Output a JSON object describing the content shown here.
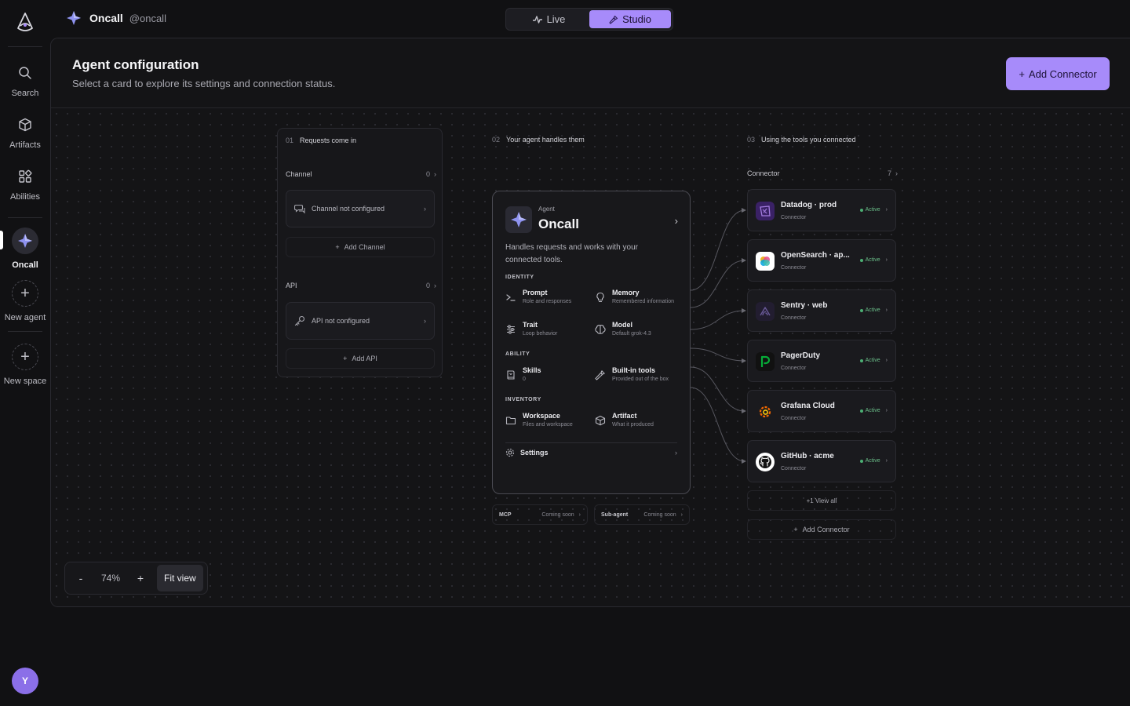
{
  "rail": {
    "items": [
      {
        "label": "Search",
        "icon": "search-icon"
      },
      {
        "label": "Artifacts",
        "icon": "cube-icon"
      },
      {
        "label": "Abilities",
        "icon": "grid-icon"
      }
    ],
    "agent_label": "Oncall",
    "new_agent_label": "New agent",
    "new_space_label": "New space",
    "avatar_initial": "Y"
  },
  "topbar": {
    "agent_name": "Oncall",
    "agent_handle": "@oncall",
    "modes": [
      {
        "label": "Live",
        "icon": "pulse-icon",
        "active": false
      },
      {
        "label": "Studio",
        "icon": "wrench-icon",
        "active": true
      }
    ]
  },
  "panel": {
    "title": "Agent configuration",
    "subtitle": "Select a card to explore its settings and connection status.",
    "add_connector_label": "Add Connector"
  },
  "col1": {
    "num": "01",
    "title": "Requests come in",
    "channel": {
      "label": "Channel",
      "count": "0",
      "empty": "Channel not configured",
      "add": "Add Channel"
    },
    "api": {
      "label": "API",
      "count": "0",
      "empty": "API not configured",
      "add": "Add API"
    }
  },
  "col2": {
    "num": "02",
    "title": "Your agent handles them",
    "agent": {
      "kicker": "Agent",
      "name": "Oncall",
      "description": "Handles requests and works with your connected tools.",
      "groups": {
        "identity": "IDENTITY",
        "ability": "ABILITY",
        "inventory": "INVENTORY"
      },
      "caps": {
        "prompt": {
          "title": "Prompt",
          "sub": "Role and responses"
        },
        "memory": {
          "title": "Memory",
          "sub": "Remembered information"
        },
        "trait": {
          "title": "Trait",
          "sub": "Loop behavior"
        },
        "model": {
          "title": "Model",
          "sub": "Default grok-4.3"
        },
        "skills": {
          "title": "Skills",
          "sub": "0"
        },
        "builtin": {
          "title": "Built-in tools",
          "sub": "Provided out of the box"
        },
        "workspace": {
          "title": "Workspace",
          "sub": "Files and workspace"
        },
        "artifact": {
          "title": "Artifact",
          "sub": "What it produced"
        }
      },
      "settings": "Settings"
    },
    "pills": [
      {
        "label": "MCP",
        "status": "Coming soon"
      },
      {
        "label": "Sub-agent",
        "status": "Coming soon"
      }
    ]
  },
  "col3": {
    "num": "03",
    "title": "Using the tools you connected",
    "label": "Connector",
    "count": "7",
    "connectors": [
      {
        "name": "Datadog · prod",
        "type": "Connector",
        "status": "Active",
        "logo": "datadog-logo",
        "color": "#632ca6"
      },
      {
        "name": "OpenSearch · ap...",
        "type": "Connector",
        "status": "Active",
        "logo": "opensearch-logo",
        "color": "#00a3e0"
      },
      {
        "name": "Sentry · web",
        "type": "Connector",
        "status": "Active",
        "logo": "sentry-logo",
        "color": "#362d59"
      },
      {
        "name": "PagerDuty",
        "type": "Connector",
        "status": "Active",
        "logo": "pagerduty-logo",
        "color": "#06ac38"
      },
      {
        "name": "Grafana Cloud",
        "type": "Connector",
        "status": "Active",
        "logo": "grafana-logo",
        "color": "#f46800"
      },
      {
        "name": "GitHub · acme",
        "type": "Connector",
        "status": "Active",
        "logo": "github-logo",
        "color": "#ffffff"
      }
    ],
    "view_all": "+1 View all",
    "add": "Add Connector"
  },
  "zoom": {
    "minus": "-",
    "value": "74%",
    "plus": "+",
    "fit": "Fit view"
  },
  "colors": {
    "accent": "#a78bfa",
    "active": "#4caf74",
    "background": "#111113"
  }
}
